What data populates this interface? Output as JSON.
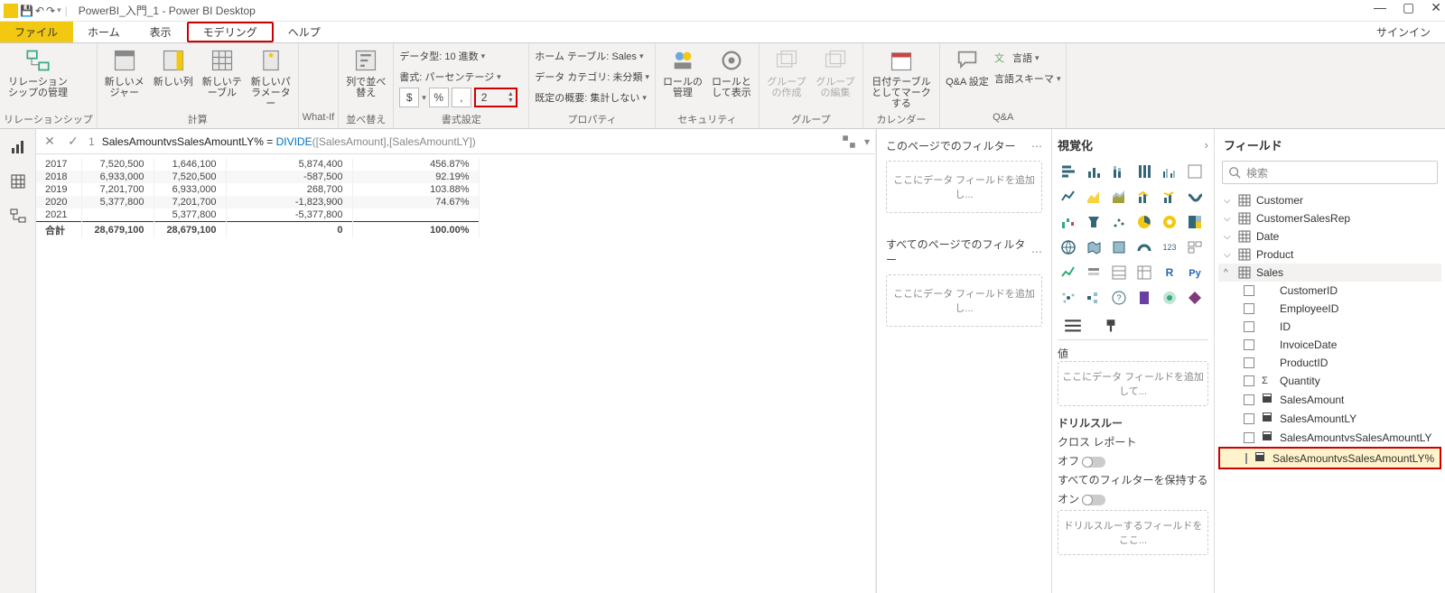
{
  "titlebar": {
    "title": "PowerBI_入門_1 - Power BI Desktop"
  },
  "menubar": {
    "file": "ファイル",
    "home": "ホーム",
    "view": "表示",
    "modeling": "モデリング",
    "help": "ヘルプ",
    "signin": "サインイン"
  },
  "ribbon": {
    "relationships": {
      "btn": "リレーションシップの管理",
      "group": "リレーションシップ"
    },
    "calc": {
      "measure": "新しいメジャー",
      "column": "新しい列",
      "table": "新しいテーブル",
      "param": "新しいパラメーター",
      "group": "計算"
    },
    "whatif": {
      "group": "What-If"
    },
    "sort": {
      "btn": "列で並べ替え",
      "group": "並べ替え"
    },
    "format": {
      "datatype": "データ型: 10 進数",
      "format": "書式: パーセンテージ",
      "decimals": "2",
      "dollar": "$",
      "percent": "%",
      "comma": ",",
      "group": "書式設定"
    },
    "props": {
      "hometable": "ホーム テーブル: Sales",
      "category": "データ カテゴリ: 未分類",
      "summary": "既定の概要: 集計しない",
      "group": "プロパティ"
    },
    "security": {
      "manage": "ロールの管理",
      "viewas": "ロールとして表示",
      "group": "セキュリティ"
    },
    "groups": {
      "new": "グループの作成",
      "edit": "グループの編集",
      "group": "グループ"
    },
    "calendar": {
      "btn": "日付テーブルとしてマークする",
      "group": "カレンダー"
    },
    "qa": {
      "btn": "Q&A 設定",
      "lang": "言語",
      "schema": "言語スキーマ",
      "group": "Q&A"
    }
  },
  "formula": {
    "prefix": "1",
    "body": "SalesAmountvsSalesAmountLY% = ",
    "fn": "DIVIDE",
    "args": "([SalesAmount],[SalesAmountLY])"
  },
  "table": {
    "rows": [
      {
        "y": "2017",
        "a": "7,520,500",
        "b": "1,646,100",
        "c": "5,874,400",
        "d": "456.87%"
      },
      {
        "y": "2018",
        "a": "6,933,000",
        "b": "7,520,500",
        "c": "-587,500",
        "d": "92.19%"
      },
      {
        "y": "2019",
        "a": "7,201,700",
        "b": "6,933,000",
        "c": "268,700",
        "d": "103.88%"
      },
      {
        "y": "2020",
        "a": "5,377,800",
        "b": "7,201,700",
        "c": "-1,823,900",
        "d": "74.67%"
      },
      {
        "y": "2021",
        "a": "",
        "b": "5,377,800",
        "c": "-5,377,800",
        "d": ""
      }
    ],
    "total": {
      "y": "合計",
      "a": "28,679,100",
      "b": "28,679,100",
      "c": "0",
      "d": "100.00%"
    }
  },
  "filters": {
    "page": {
      "title": "このページでのフィルター",
      "well": "ここにデータ フィールドを追加し..."
    },
    "all": {
      "title": "すべてのページでのフィルター",
      "well": "ここにデータ フィールドを追加し..."
    }
  },
  "viz": {
    "title": "視覚化",
    "items": [
      "bar-h",
      "bar-v",
      "bar-stack",
      "bar-100",
      "bar-clust",
      "column",
      "line",
      "area",
      "area-stack",
      "line-col",
      "line-col2",
      "ribbon",
      "waterfall",
      "funnel",
      "scatter",
      "pie",
      "donut",
      "treemap",
      "map",
      "filled-map",
      "shape-map",
      "gauge",
      "card",
      "multi-card",
      "kpi",
      "slicer",
      "table",
      "matrix",
      "r-visual",
      "py-visual",
      "key-influencer",
      "decomp",
      "qna",
      "paginated",
      "arcgis",
      "powerapps"
    ],
    "values": "値",
    "valueswell": "ここにデータ フィールドを追加して...",
    "drill": "ドリルスルー",
    "cross": "クロス レポート",
    "off": "オフ",
    "keep": "すべてのフィルターを保持する",
    "on": "オン",
    "drillwell": "ドリルスルーするフィールドをここ..."
  },
  "fields": {
    "title": "フィールド",
    "search": "検索",
    "tables": [
      "Customer",
      "CustomerSalesRep",
      "Date",
      "Product"
    ],
    "sales": {
      "name": "Sales",
      "fields": [
        {
          "icon": "",
          "name": "CustomerID"
        },
        {
          "icon": "",
          "name": "EmployeeID"
        },
        {
          "icon": "",
          "name": "ID"
        },
        {
          "icon": "",
          "name": "InvoiceDate"
        },
        {
          "icon": "",
          "name": "ProductID"
        },
        {
          "icon": "Σ",
          "name": "Quantity"
        },
        {
          "icon": "calc",
          "name": "SalesAmount"
        },
        {
          "icon": "calc",
          "name": "SalesAmountLY"
        },
        {
          "icon": "calc",
          "name": "SalesAmountvsSalesAmountLY"
        },
        {
          "icon": "calc",
          "name": "SalesAmountvsSalesAmountLY%",
          "hl": true
        }
      ]
    }
  }
}
